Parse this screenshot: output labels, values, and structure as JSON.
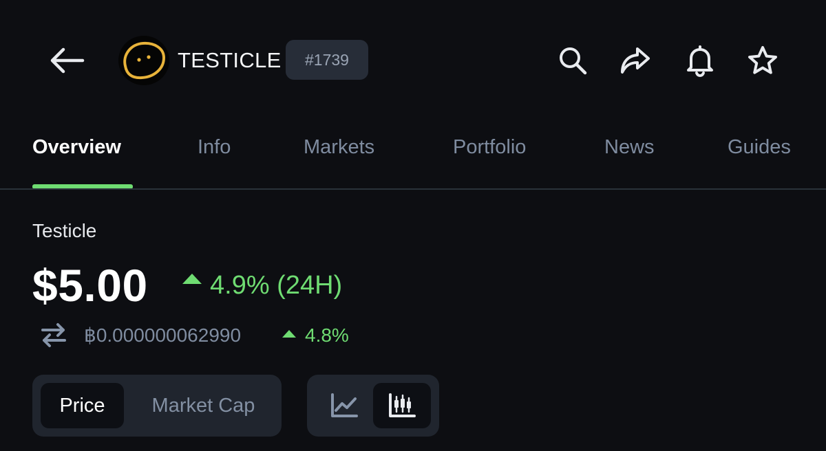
{
  "header": {
    "coin_symbol": "TESTICLE",
    "rank": "#1739",
    "icons": [
      "arrow-left-icon",
      "search-icon",
      "share-icon",
      "bell-icon",
      "star-icon"
    ]
  },
  "tabs": [
    {
      "label": "Overview",
      "active": true
    },
    {
      "label": "Info",
      "active": false
    },
    {
      "label": "Markets",
      "active": false
    },
    {
      "label": "Portfolio",
      "active": false
    },
    {
      "label": "News",
      "active": false
    },
    {
      "label": "Guides",
      "active": false
    }
  ],
  "price_section": {
    "token_name": "Testicle",
    "price": "$5.00",
    "change_24h": "4.9% (24H)",
    "btc_price": "฿0.000000062990",
    "btc_change": "4.8%"
  },
  "toggles": {
    "metric_options": [
      "Price",
      "Market Cap"
    ],
    "metric_selected": "Price",
    "chart_types": [
      "line-chart-icon",
      "candlestick-chart-icon"
    ],
    "chart_selected": "candlestick-chart-icon"
  },
  "colors": {
    "background": "#0d0e12",
    "accent_green": "#6fdc72",
    "muted_text": "#7f8ca0",
    "badge_bg": "#272d38",
    "toggle_bg": "#20252e",
    "logo_outline": "#e8b33a"
  }
}
